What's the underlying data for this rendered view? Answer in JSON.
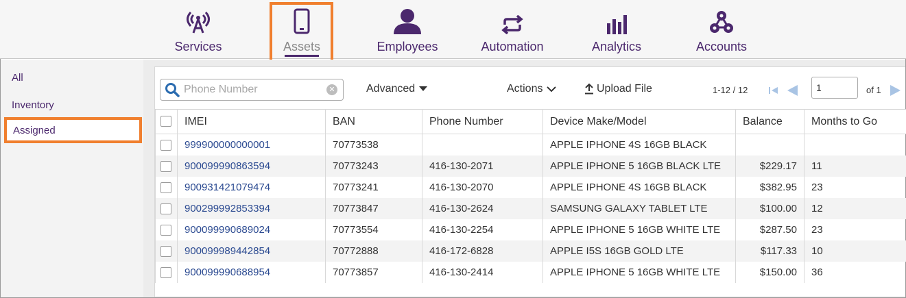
{
  "nav": {
    "items": [
      {
        "label": "Services",
        "icon": "antenna-icon"
      },
      {
        "label": "Assets",
        "icon": "mobile-phone-icon"
      },
      {
        "label": "Employees",
        "icon": "person-icon"
      },
      {
        "label": "Automation",
        "icon": "repeat-arrows-icon"
      },
      {
        "label": "Analytics",
        "icon": "bar-chart-icon"
      },
      {
        "label": "Accounts",
        "icon": "network-icon"
      }
    ],
    "active": "Assets"
  },
  "sidebar": {
    "items": [
      {
        "label": "All"
      },
      {
        "label": "Inventory"
      },
      {
        "label": "Assigned"
      }
    ],
    "selected": "Assigned"
  },
  "toolbar": {
    "search_placeholder": "Phone Number",
    "advanced_label": "Advanced",
    "actions_label": "Actions",
    "upload_label": "Upload File",
    "pager_range": "1-12 / 12",
    "page_value": "1",
    "page_of": "of 1"
  },
  "table": {
    "columns": [
      "IMEI",
      "BAN",
      "Phone Number",
      "Device Make/Model",
      "Balance",
      "Months to Go"
    ],
    "rows": [
      {
        "imei": "999900000000001",
        "ban": "70773538",
        "phone": "",
        "device": "APPLE IPHONE 4S 16GB BLACK",
        "balance": "",
        "months": ""
      },
      {
        "imei": "900099990863594",
        "ban": "70773243",
        "phone": "416-130-2071",
        "device": "APPLE IPHONE 5 16GB BLACK LTE",
        "balance": "$229.17",
        "months": "11"
      },
      {
        "imei": "900931421079474",
        "ban": "70773241",
        "phone": "416-130-2070",
        "device": "APPLE IPHONE 4S 16GB BLACK",
        "balance": "$382.95",
        "months": "23"
      },
      {
        "imei": "900299992853394",
        "ban": "70773847",
        "phone": "416-130-2624",
        "device": "SAMSUNG GALAXY TABLET LTE",
        "balance": "$100.00",
        "months": "12"
      },
      {
        "imei": "900099990689024",
        "ban": "70773554",
        "phone": "416-130-2254",
        "device": "APPLE IPHONE 5 16GB WHITE LTE",
        "balance": "$287.50",
        "months": "23"
      },
      {
        "imei": "900099989442854",
        "ban": "70772888",
        "phone": "416-172-6828",
        "device": "APPLE I5S 16GB GOLD LTE",
        "balance": "$117.33",
        "months": "10"
      },
      {
        "imei": "900099990688954",
        "ban": "70773857",
        "phone": "416-130-2414",
        "device": "APPLE IPHONE 5 16GB WHITE LTE",
        "balance": "$150.00",
        "months": "36"
      }
    ]
  },
  "colors": {
    "brand": "#4b286d",
    "highlight": "#f07f2e",
    "link": "#2b4a91"
  }
}
